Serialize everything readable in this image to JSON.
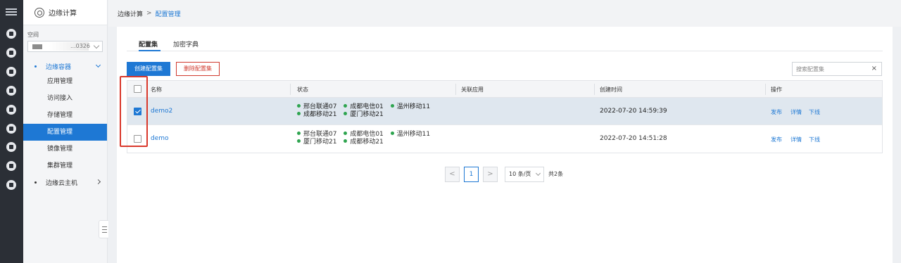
{
  "sidebar": {
    "title": "边缘计算",
    "space_label": "空间",
    "space_value": "...0326",
    "group_edge_container": "边缘容器",
    "items": [
      "应用管理",
      "访问接入",
      "存储管理",
      "配置管理",
      "镜像管理",
      "集群管理"
    ],
    "active_item": "配置管理",
    "group_edge_host": "边缘云主机"
  },
  "breadcrumb": {
    "root": "边缘计算",
    "separator": ">",
    "current": "配置管理"
  },
  "tabs": [
    "配置集",
    "加密字典"
  ],
  "toolbar": {
    "create_label": "创建配置集",
    "delete_label": "删除配置集",
    "search_placeholder": "搜索配置集",
    "clear_glyph": "×"
  },
  "table": {
    "headers": [
      "名称",
      "状态",
      "关联应用",
      "创建时间",
      "操作"
    ],
    "rows": [
      {
        "name": "demo2",
        "checked": true,
        "status_lines": [
          [
            "邢台联通07",
            "成都电信01",
            "温州移动11"
          ],
          [
            "成都移动21",
            "厦门移动21"
          ]
        ],
        "linked_app": "",
        "created": "2022-07-20 14:59:39",
        "actions": [
          "发布",
          "详情",
          "下线"
        ]
      },
      {
        "name": "demo",
        "checked": false,
        "status_lines": [
          [
            "邢台联通07",
            "成都电信01",
            "温州移动11"
          ],
          [
            "厦门移动21",
            "成都移动21"
          ]
        ],
        "linked_app": "",
        "created": "2022-07-20 14:51:28",
        "actions": [
          "发布",
          "详情",
          "下线"
        ]
      }
    ]
  },
  "pagination": {
    "prev": "<",
    "current": "1",
    "next": ">",
    "page_size": "10 条/页",
    "total": "共2条"
  },
  "colors": {
    "primary": "#1e78d4",
    "danger": "#d03a2f",
    "status_green": "#2ea44f",
    "rail": "#2b2f36"
  }
}
